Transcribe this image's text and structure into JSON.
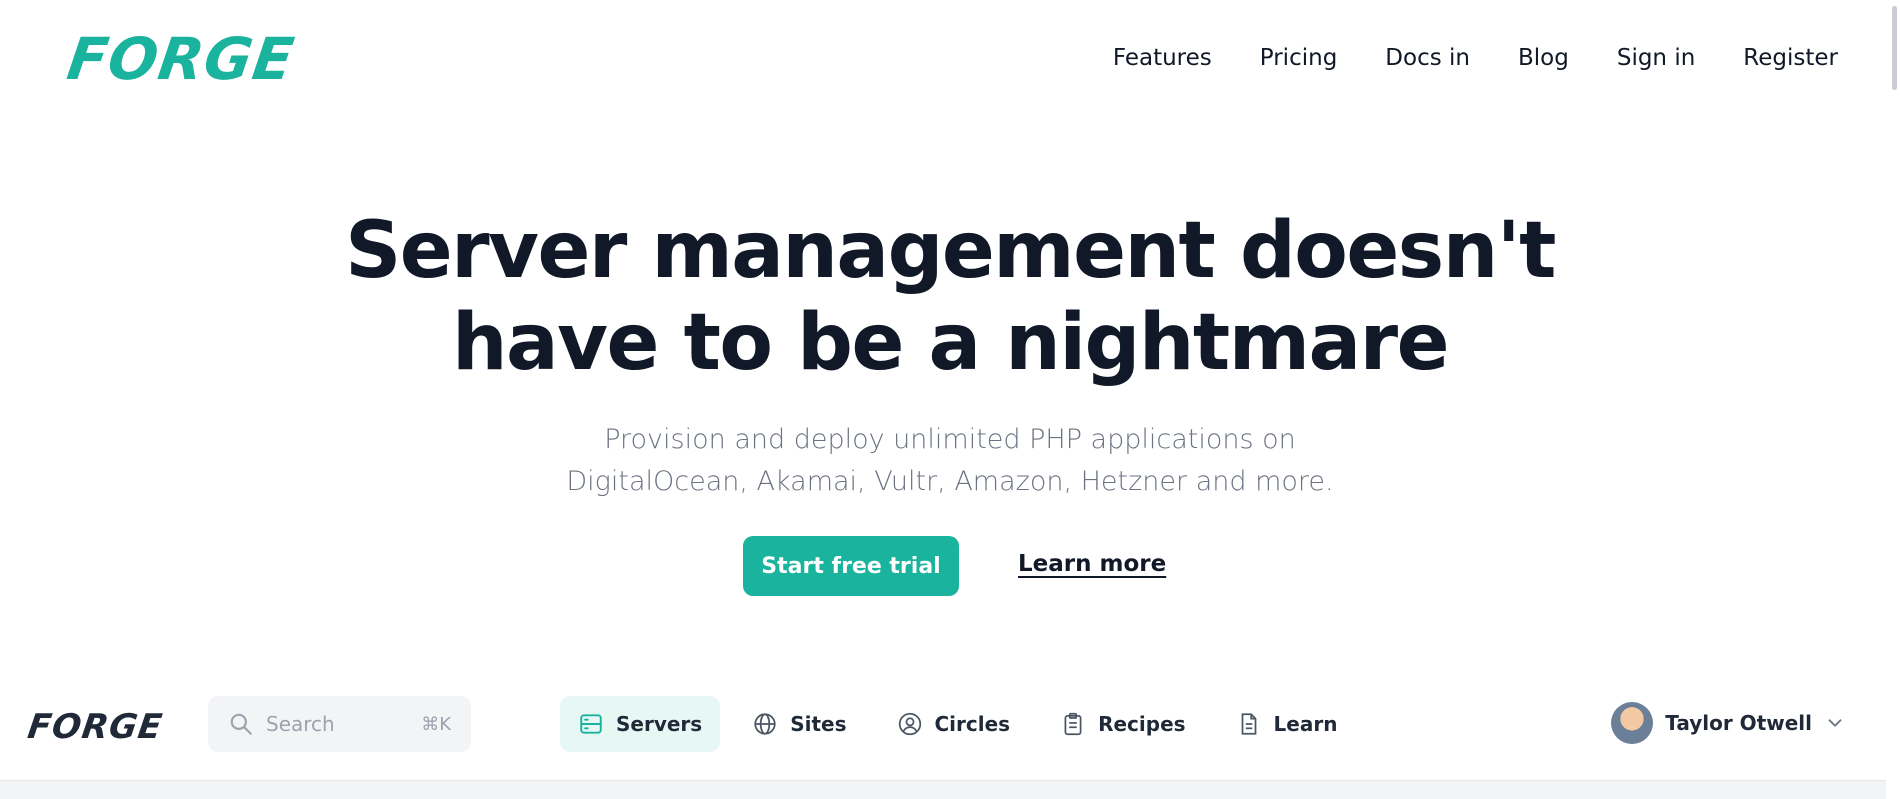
{
  "brand": {
    "name": "FORGE",
    "color": "#19b39e"
  },
  "nav": {
    "links": [
      "Features",
      "Pricing",
      "Docs in",
      "Blog",
      "Sign in",
      "Register"
    ]
  },
  "hero": {
    "title": "Server management doesn't have to be a nightmare",
    "subtitle": "Provision and deploy unlimited PHP applications on DigitalOcean, Akamai, Vultr, Amazon, Hetzner and more.",
    "primary_cta": "Start free trial",
    "secondary_cta": "Learn more"
  },
  "app_preview": {
    "logo": "FORGE",
    "search": {
      "placeholder": "Search",
      "shortcut": "⌘K",
      "icon": "search-icon"
    },
    "tabs": [
      {
        "label": "Servers",
        "icon": "server-icon",
        "active": true
      },
      {
        "label": "Sites",
        "icon": "globe-icon",
        "active": false
      },
      {
        "label": "Circles",
        "icon": "user-circle-icon",
        "active": false
      },
      {
        "label": "Recipes",
        "icon": "clipboard-icon",
        "active": false
      },
      {
        "label": "Learn",
        "icon": "document-icon",
        "active": false
      }
    ],
    "user": {
      "name": "Taylor Otwell"
    }
  },
  "colors": {
    "accent": "#19b39e",
    "active_tab_bg": "#e6f7f4",
    "text": "#111827",
    "muted": "#6b7280"
  }
}
